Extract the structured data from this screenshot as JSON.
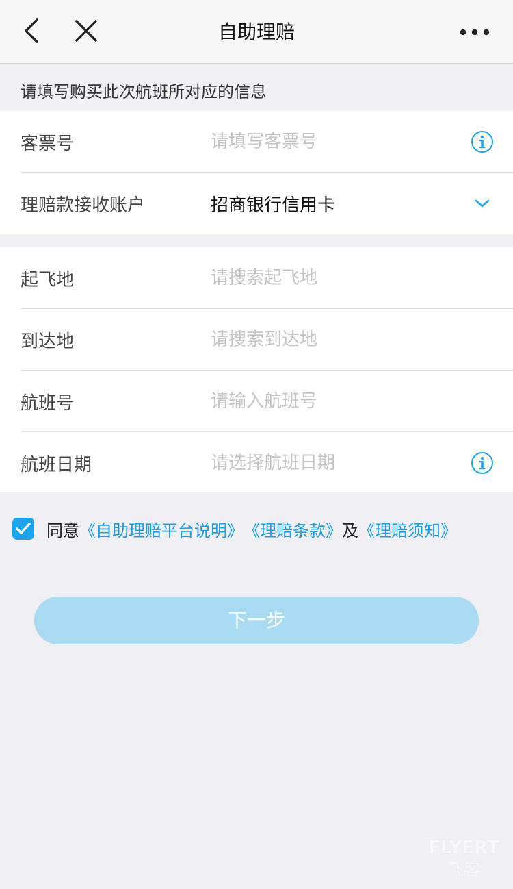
{
  "nav": {
    "title": "自助理赔",
    "back_icon": "chevron-left-icon",
    "close_icon": "close-icon",
    "more_icon": "more-dots-icon"
  },
  "section_hint": "请填写购买此次航班所对应的信息",
  "ticket": {
    "label": "客票号",
    "placeholder": "请填写客票号",
    "icon": "info-icon"
  },
  "account": {
    "label": "理赔款接收账户",
    "value": "招商银行信用卡",
    "icon": "chevron-down-icon"
  },
  "departure": {
    "label": "起飞地",
    "placeholder": "请搜索起飞地"
  },
  "arrival": {
    "label": "到达地",
    "placeholder": "请搜索到达地"
  },
  "flight_no": {
    "label": "航班号",
    "placeholder": "请输入航班号"
  },
  "flight_date": {
    "label": "航班日期",
    "placeholder": "请选择航班日期",
    "icon": "info-icon"
  },
  "agreement": {
    "checked": true,
    "prefix": "同意",
    "link1": "《自助理赔平台说明》",
    "link2": "《理赔条款》",
    "conjunction": "及",
    "link3": "《理赔须知》"
  },
  "next_button": "下一步",
  "watermark": {
    "top": "FLYERT",
    "bottom": "飞客"
  },
  "colors": {
    "accent": "#1aa3ef",
    "link": "#1a9ee6",
    "button_disabled": "#a8dbf1",
    "background": "#efeff4"
  }
}
